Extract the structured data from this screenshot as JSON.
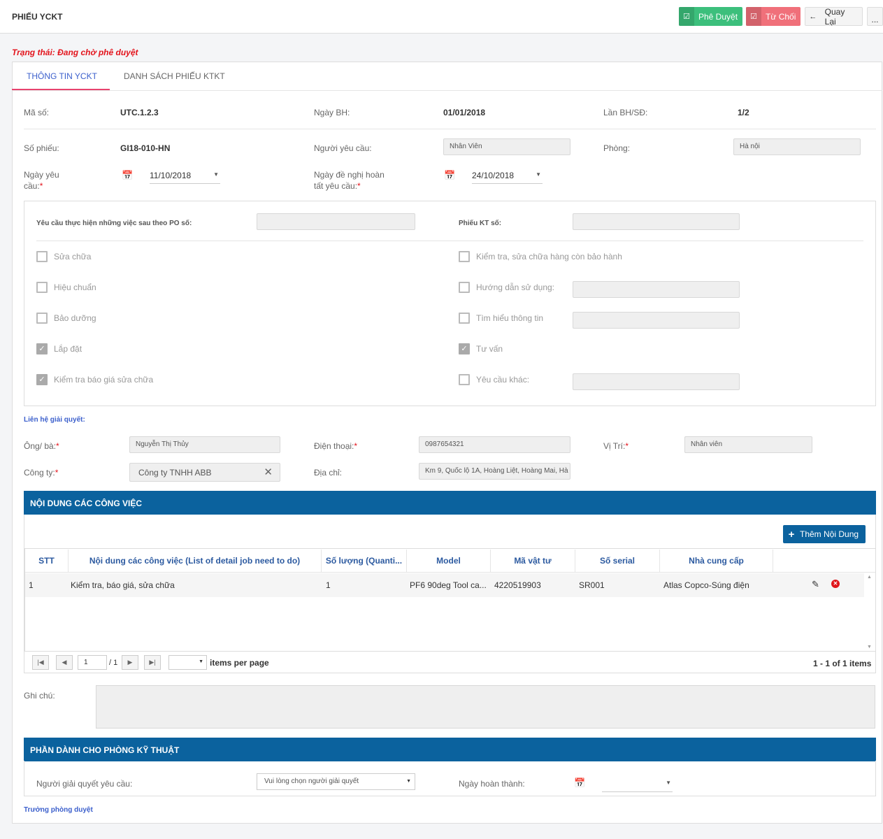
{
  "header": {
    "title": "PHIẾU YCKT",
    "approve_label": "Phê Duyệt",
    "reject_label": "Từ Chối",
    "back_label": "Quay Lại",
    "more_label": "..."
  },
  "status_text": "Trạng thái: Đang chờ phê duyệt",
  "tabs": [
    {
      "label": "THÔNG TIN YCKT",
      "active": true
    },
    {
      "label": "DANH SÁCH PHIẾU KTKT",
      "active": false
    }
  ],
  "info": {
    "ma_so_label": "Mã số:",
    "ma_so": "UTC.1.2.3",
    "ngay_bh_label": "Ngày BH:",
    "ngay_bh": "01/01/2018",
    "lan_bh_label": "Lần BH/SĐ:",
    "lan_bh": "1/2",
    "so_phieu_label": "Số phiếu:",
    "so_phieu": "GI18-010-HN",
    "nguoi_yc_label": "Người yêu cầu:",
    "nguoi_yc": "Nhân Viên",
    "phong_label": "Phòng:",
    "phong": "Hà nội",
    "ngay_yc_label_1": "Ngày yêu",
    "ngay_yc_label_2": "cầu:",
    "ngay_yc": "11/10/2018",
    "ngay_de_nghi_label_1": "Ngày đề nghị hoàn",
    "ngay_de_nghi_label_2": "tất yêu cầu:",
    "ngay_de_nghi": "24/10/2018",
    "required_mark": "*"
  },
  "request": {
    "po_label": "Yêu cầu thực hiện những việc sau theo PO số:",
    "po_value": "",
    "kt_label": "Phiếu KT số:",
    "kt_value": "",
    "left_items": [
      {
        "label": "Sửa chữa",
        "checked": false
      },
      {
        "label": "Hiệu chuẩn",
        "checked": false
      },
      {
        "label": "Bảo dưỡng",
        "checked": false
      },
      {
        "label": "Lắp đặt",
        "checked": true
      },
      {
        "label": "Kiểm tra báo giá sửa chữa",
        "checked": true
      }
    ],
    "right_items": [
      {
        "label": "Kiểm tra, sửa chữa hàng còn bảo hành",
        "checked": false
      },
      {
        "label": "Hướng dẫn sử dụng:",
        "checked": false
      },
      {
        "label": "Tìm hiểu thông tin",
        "checked": false
      },
      {
        "label": "Tư vấn",
        "checked": true
      },
      {
        "label": "Yêu cầu khác:",
        "checked": false
      }
    ],
    "check_mark": "✓"
  },
  "contact": {
    "section_label": "Liên hệ giải quyết:",
    "ong_ba_label": "Ông/ bà:",
    "ong_ba": "Nguyễn Thị Thủy",
    "dien_thoai_label": "Điện thoại:",
    "dien_thoai": "0987654321",
    "vi_tri_label": "Vị Trí:",
    "vi_tri": "Nhân viên",
    "cong_ty_label": "Công ty:",
    "cong_ty": "Công ty TNHH ABB",
    "dia_chi_label": "Địa chỉ:",
    "dia_chi": "Km 9, Quốc lộ 1A, Hoàng Liệt, Hoàng Mai, Hà"
  },
  "jobs": {
    "title": "NỘI DUNG CÁC CÔNG VIỆC",
    "add_label": "Thêm Nội Dung",
    "columns": [
      "STT",
      "Nội dung các công việc (List of detail job need to do)",
      "Số lượng (Quanti...",
      "Model",
      "Mã vật tư",
      "Số serial",
      "Nhà cung cấp"
    ],
    "rows": [
      [
        "1",
        "Kiểm tra, báo giá, sửa chữa",
        "1",
        "PF6 90deg Tool ca...",
        "4220519903",
        "SR001",
        "Atlas Copco-Súng điện"
      ]
    ],
    "pager": {
      "page": "1",
      "of_pages": "/ 1",
      "per_page_label": "items per page",
      "summary": "1 - 1 of 1 items"
    }
  },
  "note": {
    "label": "Ghi chú:",
    "value": ""
  },
  "tech": {
    "title": "PHẦN DÀNH CHO PHÒNG KỸ THUẬT",
    "resolver_label": "Người giải quyết yêu cầu:",
    "resolver_placeholder": "Vui lòng chọn người giải quyết",
    "done_date_label": "Ngày hoàn thành:",
    "approver_label": "Trưởng phòng duyệt"
  },
  "colors": {
    "approve": "#3cbf7c",
    "reject": "#f0707a",
    "section": "#0b629e",
    "status": "#e3141c",
    "tab_active": "#3b5fcc"
  }
}
